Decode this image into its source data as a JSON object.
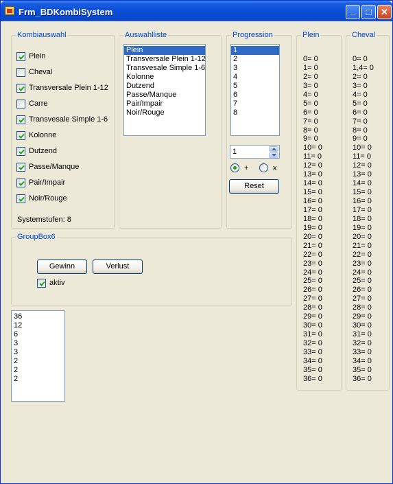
{
  "window": {
    "title": "Frm_BDKombiSystem",
    "minimize": "_",
    "maximize": "□",
    "close": "✕",
    "icon": "app-icon"
  },
  "kombiauswahl": {
    "title": "Kombiauswahl",
    "items": [
      {
        "label": "Plein",
        "checked": true
      },
      {
        "label": "Cheval",
        "checked": false
      },
      {
        "label": "Transversale Plein 1-12",
        "checked": true
      },
      {
        "label": "Carre",
        "checked": false
      },
      {
        "label": "Transvesale Simple 1-6",
        "checked": true
      },
      {
        "label": "Kolonne",
        "checked": true
      },
      {
        "label": "Dutzend",
        "checked": true
      },
      {
        "label": "Passe/Manque",
        "checked": true
      },
      {
        "label": "Pair/Impair",
        "checked": true
      },
      {
        "label": "Noir/Rouge",
        "checked": true
      }
    ],
    "systemstufen": "Systemstufen: 8"
  },
  "auswahlliste": {
    "title": "Auswahlliste",
    "items": [
      "Plein",
      "Transversale Plein 1-12",
      "Transvesale Simple 1-6",
      "Kolonne",
      "Dutzend",
      "Passe/Manque",
      "Pair/Impair",
      "Noir/Rouge"
    ],
    "selected": "Plein"
  },
  "progression": {
    "title": "Progression",
    "items": [
      "1",
      "2",
      "3",
      "4",
      "5",
      "6",
      "7",
      "8"
    ],
    "selected": "1",
    "spin_value": "1",
    "radio_plus": {
      "label": "+",
      "checked": true
    },
    "radio_x": {
      "label": "x",
      "checked": false
    },
    "reset_label": "Reset"
  },
  "groupbox6": {
    "title": "GroupBox6",
    "gewinn_label": "Gewinn",
    "verlust_label": "Verlust",
    "aktiv_label": "aktiv",
    "aktiv_checked": true
  },
  "result_list": [
    "36",
    "12",
    "6",
    "3",
    "3",
    "2",
    "2",
    "2"
  ],
  "plein": {
    "title": "Plein",
    "lines": [
      "0= 0",
      "1= 0",
      "2= 0",
      "3= 0",
      "4= 0",
      "5= 0",
      "6= 0",
      "7= 0",
      "8= 0",
      "9= 0",
      "10= 0",
      "11= 0",
      "12= 0",
      "13= 0",
      "14= 0",
      "15= 0",
      "16= 0",
      "17= 0",
      "18= 0",
      "19= 0",
      "20= 0",
      "21= 0",
      "22= 0",
      "23= 0",
      "24= 0",
      "25= 0",
      "26= 0",
      "27= 0",
      "28= 0",
      "29= 0",
      "30= 0",
      "31= 0",
      "32= 0",
      "33= 0",
      "34= 0",
      "35= 0",
      "36= 0"
    ]
  },
  "cheval": {
    "title": "Cheval",
    "lines": [
      "0= 0",
      "1,4= 0",
      "2= 0",
      "3= 0",
      "4= 0",
      "5= 0",
      "6= 0",
      "7= 0",
      "8= 0",
      "9= 0",
      "10= 0",
      "11= 0",
      "12= 0",
      "13= 0",
      "14= 0",
      "15= 0",
      "16= 0",
      "17= 0",
      "18= 0",
      "19= 0",
      "20= 0",
      "21= 0",
      "22= 0",
      "23= 0",
      "24= 0",
      "25= 0",
      "26= 0",
      "27= 0",
      "28= 0",
      "29= 0",
      "30= 0",
      "31= 0",
      "32= 0",
      "33= 0",
      "34= 0",
      "35= 0",
      "36= 0"
    ]
  },
  "colors": {
    "titlebar": "#0a4ed8",
    "legend": "#0046d5",
    "selection": "#316ac5",
    "window_bg": "#ece9d8"
  }
}
